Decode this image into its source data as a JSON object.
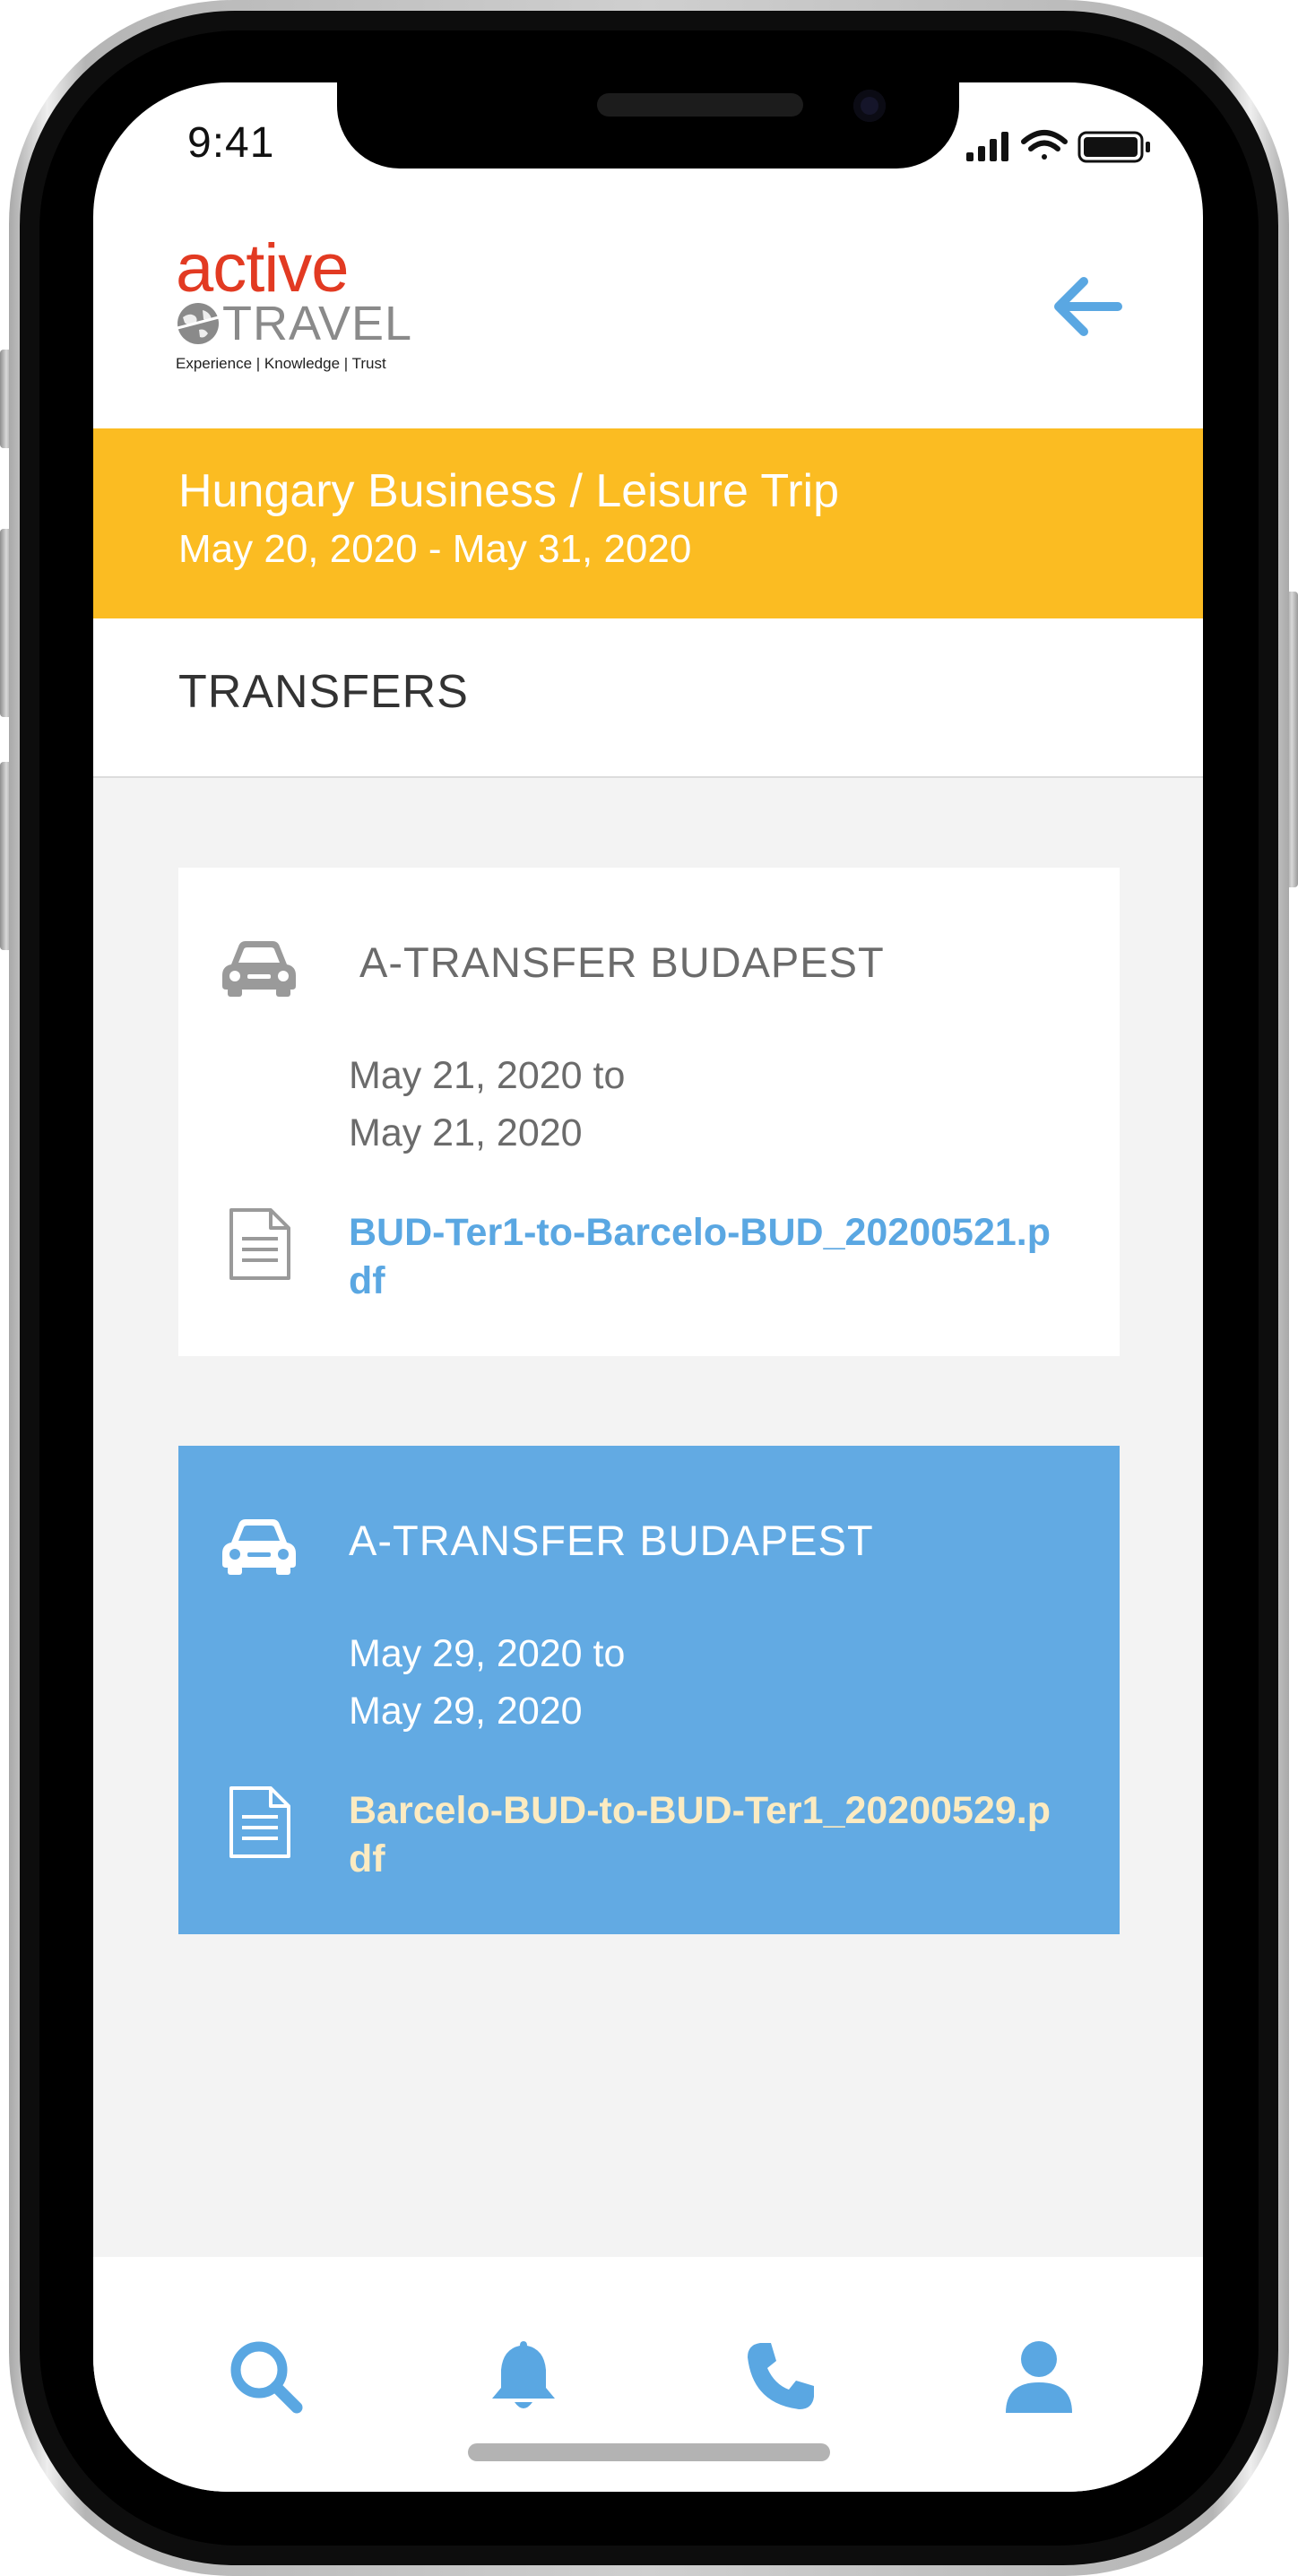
{
  "status_bar": {
    "time": "9:41"
  },
  "header": {
    "logo": {
      "word1": "active",
      "word2": "TRAVEL",
      "tagline": "Experience | Knowledge | Trust"
    },
    "back_icon": "arrow-left-icon"
  },
  "trip": {
    "title": "Hungary Business / Leisure Trip",
    "dates": "May 20, 2020 - May 31, 2020"
  },
  "section": {
    "title": "TRANSFERS"
  },
  "transfers": [
    {
      "title": "A-TRANSFER BUDAPEST",
      "date_from": "May 21, 2020 to",
      "date_to": "May 21, 2020",
      "file": "BUD-Ter1-to-Barcelo-BUD_20200521.pdf",
      "selected": false
    },
    {
      "title": "A-TRANSFER BUDAPEST",
      "date_from": "May 29, 2020 to",
      "date_to": "May 29, 2020",
      "file": "Barcelo-BUD-to-BUD-Ter1_20200529.pdf",
      "selected": true
    }
  ],
  "bottom_nav": [
    "search-icon",
    "bell-icon",
    "phone-icon",
    "user-icon"
  ],
  "colors": {
    "brand_red": "#e23a22",
    "banner_yellow": "#fbbc22",
    "accent_blue": "#5aa7e2",
    "selected_card": "#62aae3",
    "selected_link": "#fcebc1"
  }
}
